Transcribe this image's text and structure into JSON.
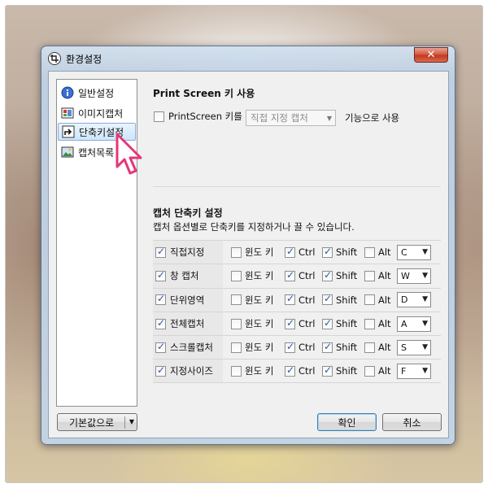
{
  "window": {
    "title": "환경설정",
    "close_symbol": "✕"
  },
  "sidebar": {
    "items": [
      {
        "label": "일반설정",
        "icon": "general-settings-icon"
      },
      {
        "label": "이미지캡처",
        "icon": "image-capture-icon"
      },
      {
        "label": "단축키설정",
        "icon": "shortcut-icon",
        "selected": true
      },
      {
        "label": "캡처목록",
        "icon": "capture-list-icon"
      }
    ]
  },
  "printscreen": {
    "title": "Print Screen 키 사용",
    "checkbox_label": "PrintScreen 키를",
    "checked": false,
    "select_value": "직접 지정 캡처",
    "suffix": "기능으로 사용"
  },
  "capture_shortcuts": {
    "title": "캡처 단축키 설정",
    "description": "캡처 옵션별로 단축키를 지정하거나 끌 수 있습니다.",
    "modifier_labels": {
      "win": "윈도 키",
      "ctrl": "Ctrl",
      "shift": "Shift",
      "alt": "Alt"
    },
    "rows": [
      {
        "name": "직접지정",
        "enabled": true,
        "win": false,
        "ctrl": true,
        "shift": true,
        "alt": false,
        "key": "C"
      },
      {
        "name": "창 캡처",
        "enabled": true,
        "win": false,
        "ctrl": true,
        "shift": true,
        "alt": false,
        "key": "W"
      },
      {
        "name": "단위영역",
        "enabled": true,
        "win": false,
        "ctrl": true,
        "shift": true,
        "alt": false,
        "key": "D"
      },
      {
        "name": "전체캡처",
        "enabled": true,
        "win": false,
        "ctrl": true,
        "shift": true,
        "alt": false,
        "key": "A"
      },
      {
        "name": "스크롤캡처",
        "enabled": true,
        "win": false,
        "ctrl": true,
        "shift": true,
        "alt": false,
        "key": "S"
      },
      {
        "name": "지정사이즈",
        "enabled": true,
        "win": false,
        "ctrl": true,
        "shift": true,
        "alt": false,
        "key": "F"
      }
    ]
  },
  "footer": {
    "defaults_label": "기본값으로",
    "ok_label": "확인",
    "cancel_label": "취소"
  },
  "colors": {
    "accent": "#3c7fb1",
    "checkmark": "#2f56a8",
    "close": "#c2381f",
    "cursor": "#e5367a"
  }
}
